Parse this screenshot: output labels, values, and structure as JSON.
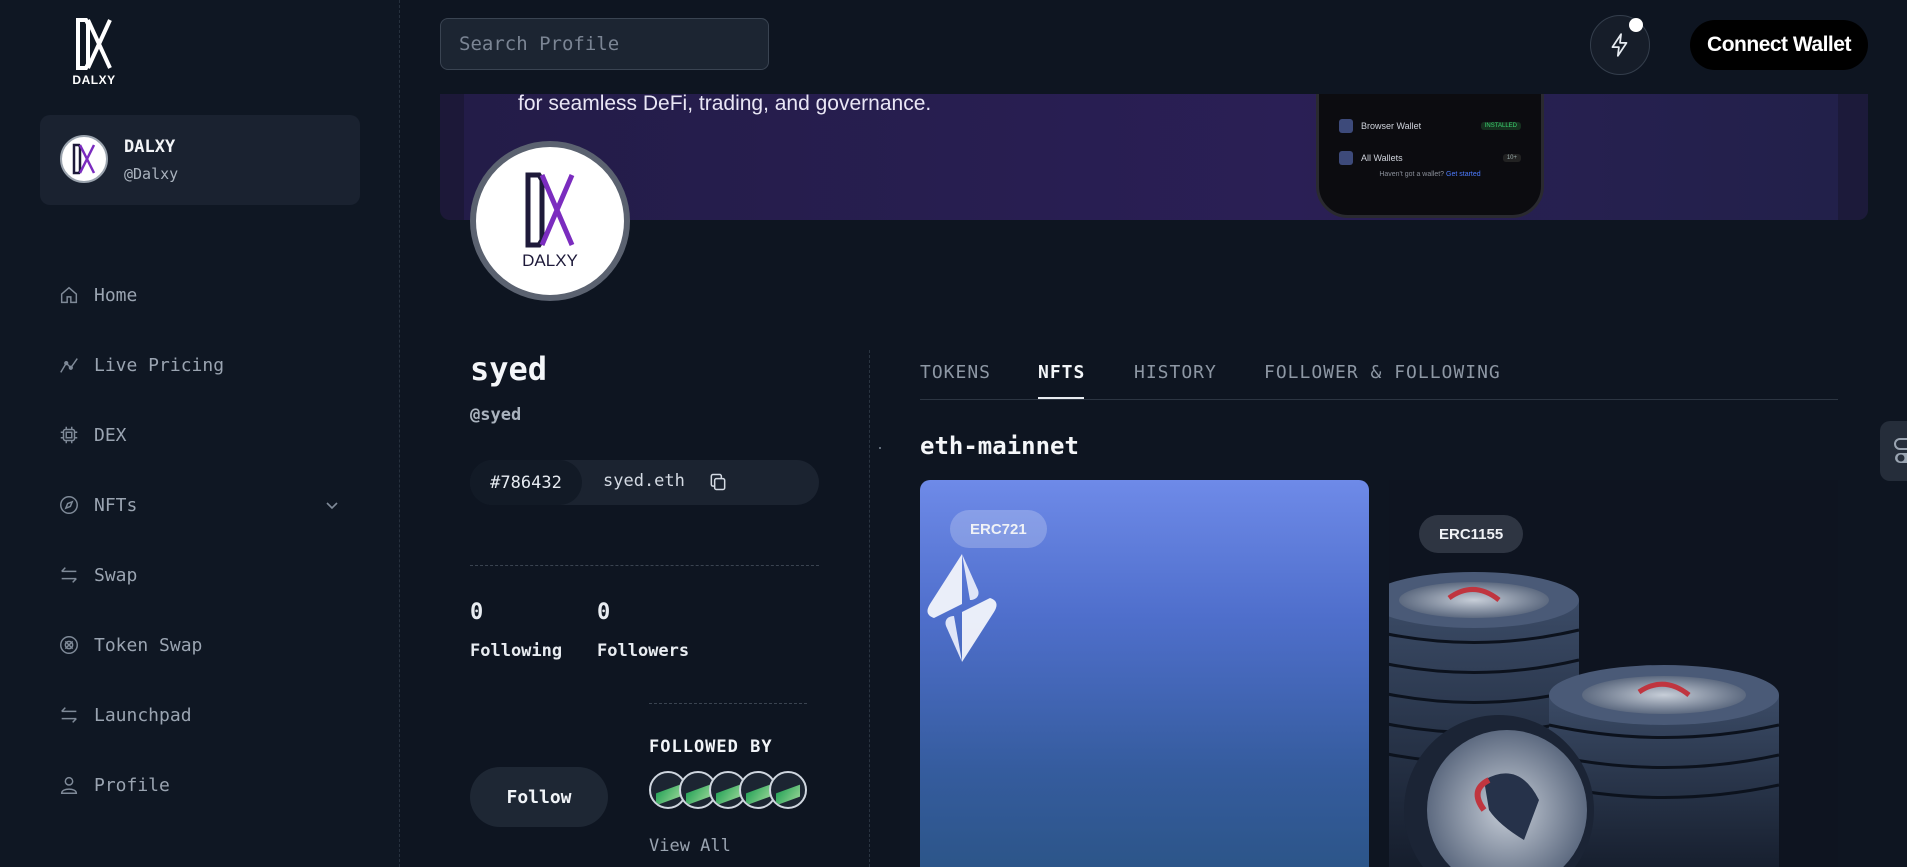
{
  "sidebar": {
    "logo_text": "DALXY",
    "user": {
      "name": "DALXY",
      "handle": "@Dalxy",
      "avatar_text": "DALXY"
    },
    "nav": [
      {
        "label": "Home",
        "icon": "home-icon"
      },
      {
        "label": "Live Pricing",
        "icon": "chart-line-icon"
      },
      {
        "label": "DEX",
        "icon": "cpu-icon"
      },
      {
        "label": "NFTs",
        "icon": "compass-icon"
      },
      {
        "label": "Swap",
        "icon": "swap-arrows-icon"
      },
      {
        "label": "Token Swap",
        "icon": "coin-icon"
      },
      {
        "label": "Launchpad",
        "icon": "swap-arrows-icon"
      },
      {
        "label": "Profile",
        "icon": "user-icon"
      }
    ]
  },
  "topbar": {
    "search_placeholder": "Search Profile",
    "connect_label": "Connect Wallet"
  },
  "banner": {
    "text": "for seamless DeFi, trading, and governance.",
    "phone": {
      "row1_label": "Browser Wallet",
      "row1_badge": "INSTALLED",
      "row2_label": "All Wallets",
      "row2_badge": "10+",
      "footer_text": "Haven't got a wallet?",
      "footer_link": "Get started"
    }
  },
  "profile": {
    "avatar_text": "DALXY",
    "name": "syed",
    "handle": "@syed",
    "id": "#786432",
    "ens": "syed.eth",
    "following_count": "0",
    "following_label": "Following",
    "followers_count": "0",
    "followers_label": "Followers",
    "follow_label": "Follow",
    "followed_by_title": "FOLLOWED BY",
    "view_all_label": "View All"
  },
  "tabs": [
    {
      "label": "TOKENS"
    },
    {
      "label": "NFTS"
    },
    {
      "label": "HISTORY"
    },
    {
      "label": "FOLLOWER & FOLLOWING"
    }
  ],
  "nfts": {
    "chain": "eth-mainnet",
    "cards": [
      {
        "standard": "ERC721"
      },
      {
        "standard": "ERC1155"
      }
    ]
  },
  "colors": {
    "background": "#0e1521",
    "sidebar": "#0f1723",
    "accent_purple": "#7b2cbf",
    "nft_gradient_top": "#6e8ae8"
  }
}
